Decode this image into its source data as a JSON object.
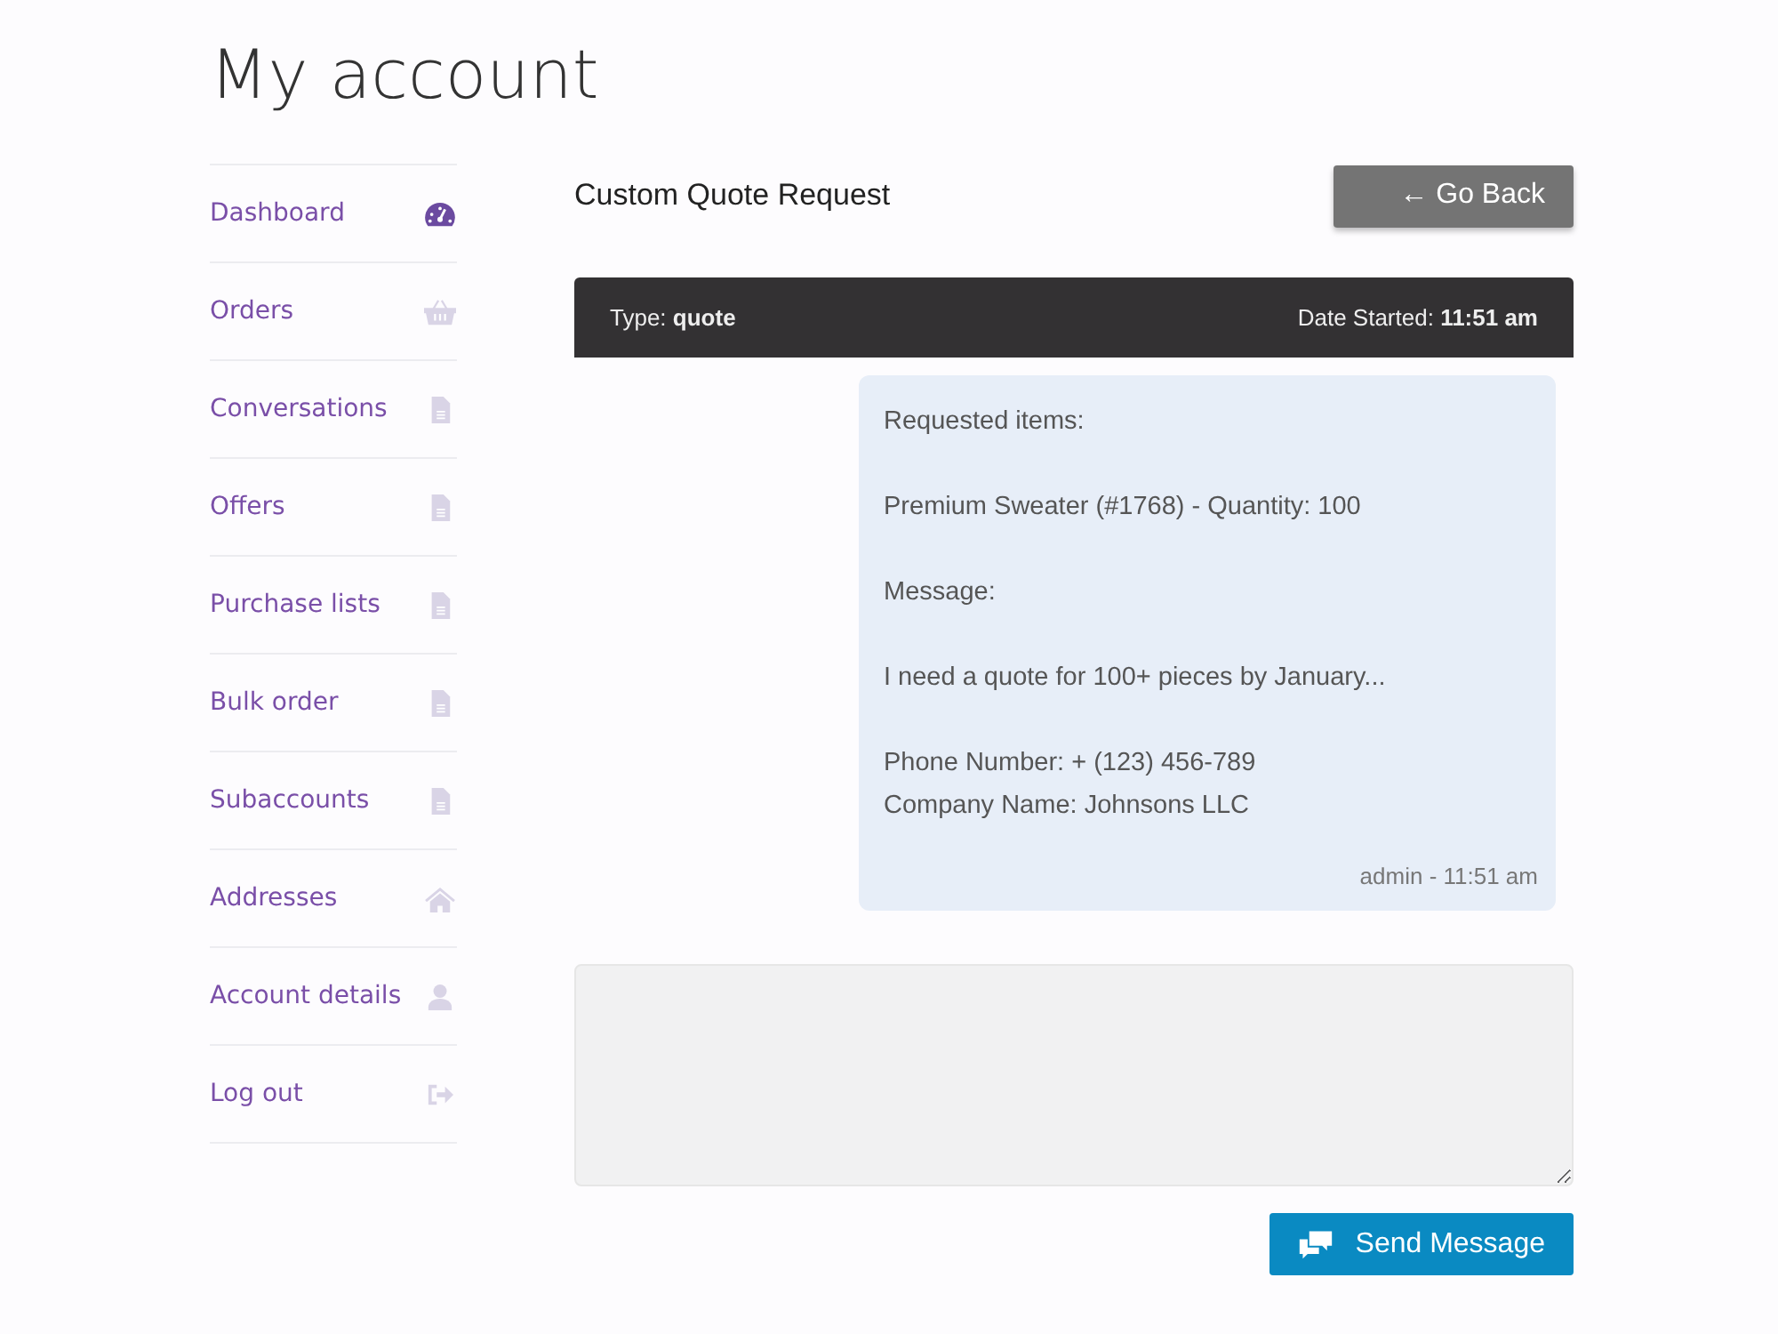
{
  "page_title": "My account",
  "sidebar": {
    "items": [
      {
        "label": "Dashboard",
        "selected": true
      },
      {
        "label": "Orders",
        "selected": false
      },
      {
        "label": "Conversations",
        "selected": false
      },
      {
        "label": "Offers",
        "selected": false
      },
      {
        "label": "Purchase lists",
        "selected": false
      },
      {
        "label": "Bulk order",
        "selected": false
      },
      {
        "label": "Subaccounts",
        "selected": false
      },
      {
        "label": "Addresses",
        "selected": false
      },
      {
        "label": "Account details",
        "selected": false
      },
      {
        "label": "Log out",
        "selected": false
      }
    ]
  },
  "conversation": {
    "title": "Custom Quote Request",
    "back_button": "← Go Back",
    "header": {
      "type": "Type: **quote**",
      "date": "Date Started: **11:51 am**"
    },
    "messages": [
      {
        "paragraphs": [
          [
            "Requested items:"
          ],
          [
            "Premium Sweater (#1768) - Quantity: 100"
          ],
          [
            "Message:"
          ],
          [
            "I need a quote for 100+ pieces by January..."
          ],
          [
            "Phone Number: + (123) 456-789",
            "Company Name: Johnsons LLC"
          ]
        ],
        "meta": "admin - 11:51 am"
      }
    ],
    "send_button": "Send Message"
  }
}
